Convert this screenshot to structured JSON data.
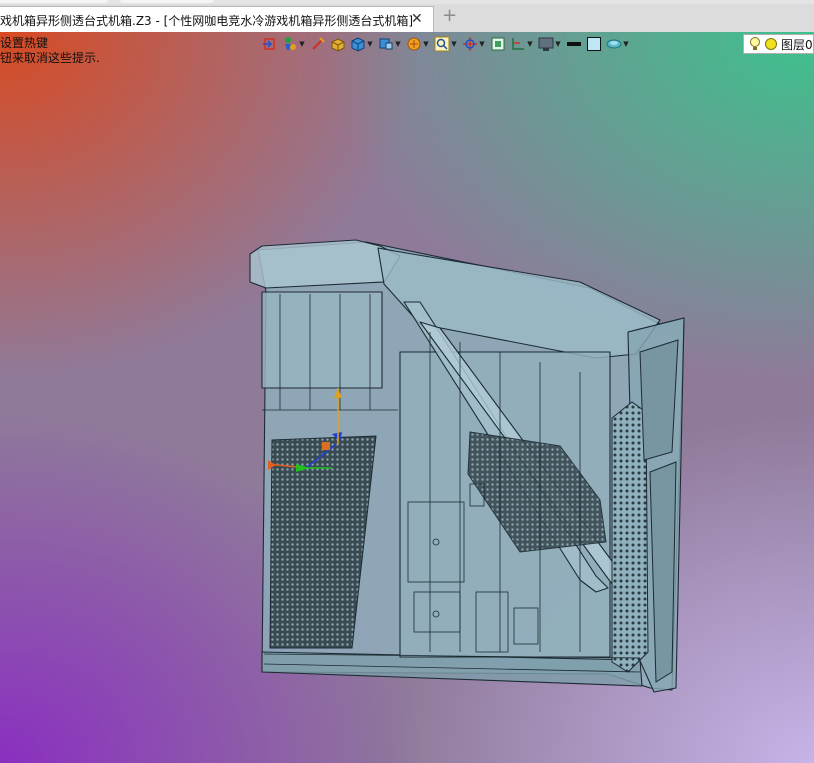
{
  "tabs": {
    "document_title": "戏机箱异形侧透台式机箱.Z3 - [个性网咖电竞水冷游戏机箱异形侧透台式机箱]",
    "close_glyph": "✕",
    "new_tab_glyph": "+"
  },
  "hints": {
    "line1": "设置热键",
    "line2": "钮来取消这些提示."
  },
  "toolbar": {
    "icons": [
      "exit-icon",
      "filter-icon",
      "pick-icon",
      "cube-shaded-icon",
      "cube-icon",
      "view-icon",
      "render-icon",
      "zoom-icon",
      "rotate-icon",
      "frame-icon",
      "axis-icon",
      "display-icon",
      "line-icon",
      "color-swatch-icon",
      "layer-shape-icon"
    ],
    "layer_label": "图层0"
  },
  "colors": {
    "case_fill": "#8fb0bd",
    "case_edge": "#1c2b33",
    "bg_orange": "#d84a22",
    "bg_green": "#3cc28c",
    "bg_purple": "#8a2fc0",
    "bg_lavender": "#c7b4e8"
  }
}
